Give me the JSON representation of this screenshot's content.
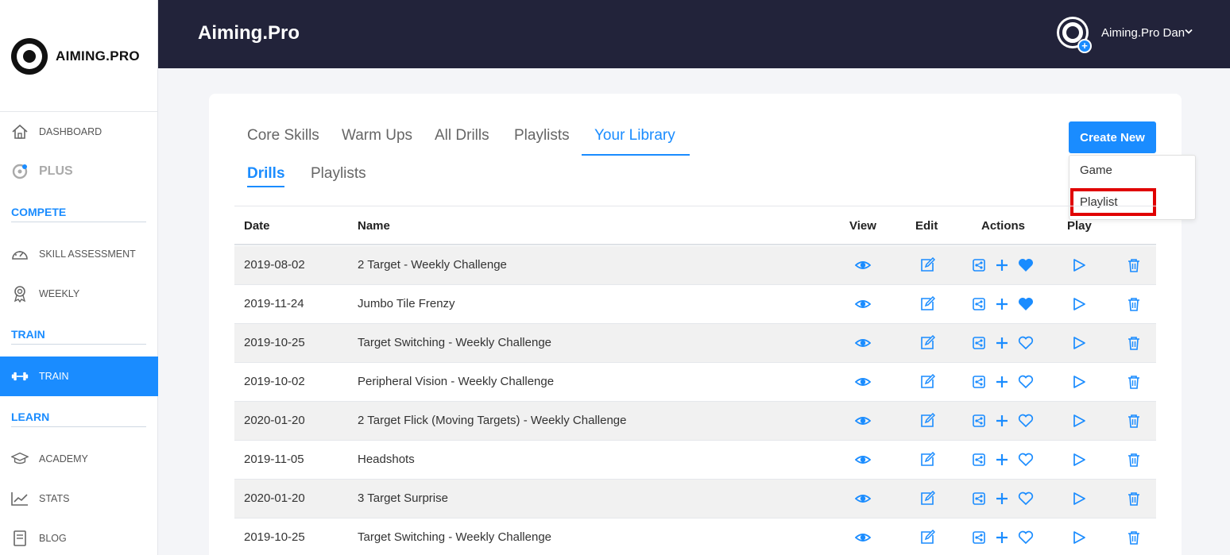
{
  "sidebar": {
    "logo_text": "AIMING.PRO",
    "dashboard": "DASHBOARD",
    "plus": "PLUS",
    "compete": "COMPETE",
    "skill_assessment": "SKILL ASSESSMENT",
    "weekly": "WEEKLY",
    "train_section": "TRAIN",
    "train": "TRAIN",
    "learn": "LEARN",
    "academy": "ACADEMY",
    "stats": "STATS",
    "blog": "BLOG"
  },
  "header": {
    "title": "Aiming.Pro",
    "user_name": "Aiming.Pro Dan",
    "badge": "+"
  },
  "tabs": [
    "Core Skills",
    "Warm Ups",
    "All Drills",
    "Playlists",
    "Your Library"
  ],
  "subtabs": [
    "Drills",
    "Playlists"
  ],
  "create_new": {
    "label": "Create New",
    "options": [
      "Game",
      "Playlist"
    ]
  },
  "table": {
    "headers": [
      "Date",
      "Name",
      "View",
      "Edit",
      "Actions",
      "Play"
    ],
    "rows": [
      {
        "date": "2019-08-02",
        "name": "2 Target - Weekly Challenge",
        "favorite": true
      },
      {
        "date": "2019-11-24",
        "name": "Jumbo Tile Frenzy",
        "favorite": true
      },
      {
        "date": "2019-10-25",
        "name": "Target Switching - Weekly Challenge",
        "favorite": false
      },
      {
        "date": "2019-10-02",
        "name": "Peripheral Vision - Weekly Challenge",
        "favorite": false
      },
      {
        "date": "2020-01-20",
        "name": "2 Target Flick (Moving Targets) - Weekly Challenge",
        "favorite": false
      },
      {
        "date": "2019-11-05",
        "name": "Headshots",
        "favorite": false
      },
      {
        "date": "2020-01-20",
        "name": "3 Target Surprise",
        "favorite": false
      },
      {
        "date": "2019-10-25",
        "name": "Target Switching - Weekly Challenge",
        "favorite": false
      }
    ]
  },
  "colors": {
    "accent": "#1a8cff",
    "header_bg": "#22233a",
    "highlight": "#e00000"
  }
}
